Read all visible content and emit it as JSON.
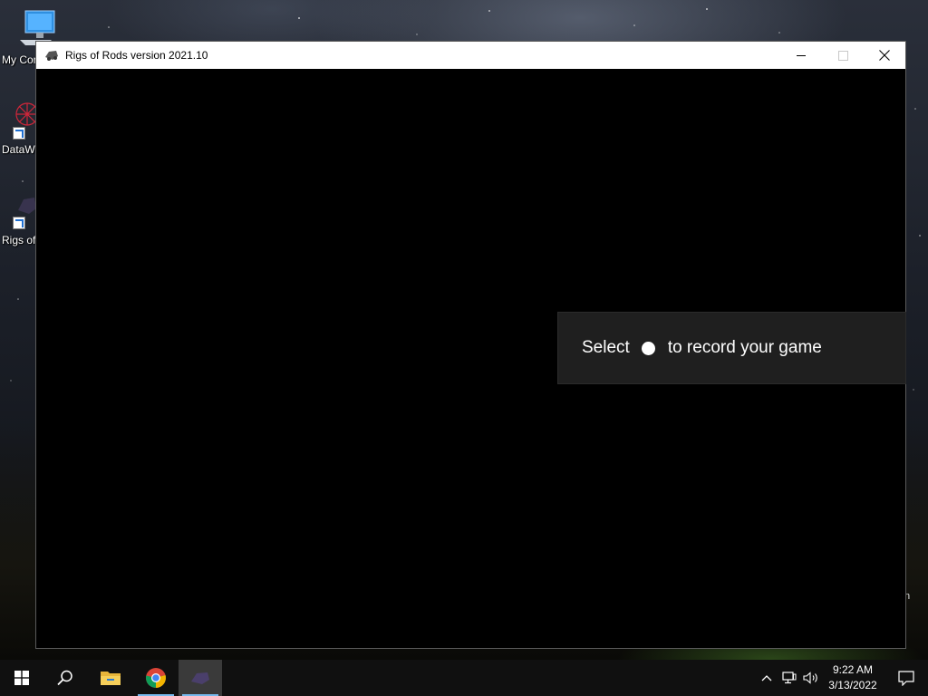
{
  "desktop": {
    "icons": [
      {
        "label": "My Com",
        "icon": "computer-icon"
      },
      {
        "label": "DataW",
        "icon": "datawarrior-icon"
      },
      {
        "label": "Rigs of",
        "icon": "rigs-of-rods-icon"
      }
    ],
    "edge_text": "n"
  },
  "window": {
    "title": "Rigs of Rods version 2021.10",
    "app_icon": "rigs-of-rods-icon",
    "controls": {
      "minimize": "minimize-icon",
      "maximize": "maximize-icon",
      "close": "close-icon"
    }
  },
  "game_bar_toast": {
    "text_before": "Select",
    "icon": "record-dot-icon",
    "text_after": "to record your game"
  },
  "taskbar": {
    "items": [
      "start-icon",
      "search-icon",
      "file-explorer-icon",
      "chrome-icon",
      "rigs-of-rods-icon"
    ],
    "tray": [
      "chevron-up-icon",
      "network-icon",
      "volume-icon"
    ],
    "time": "9:22 AM",
    "date": "3/13/2022",
    "notification": "action-center-icon"
  },
  "colors": {
    "accent_underline": "#76b9ed",
    "toast_bg": "#1f1f1f",
    "taskbar_bg": "#101010"
  }
}
